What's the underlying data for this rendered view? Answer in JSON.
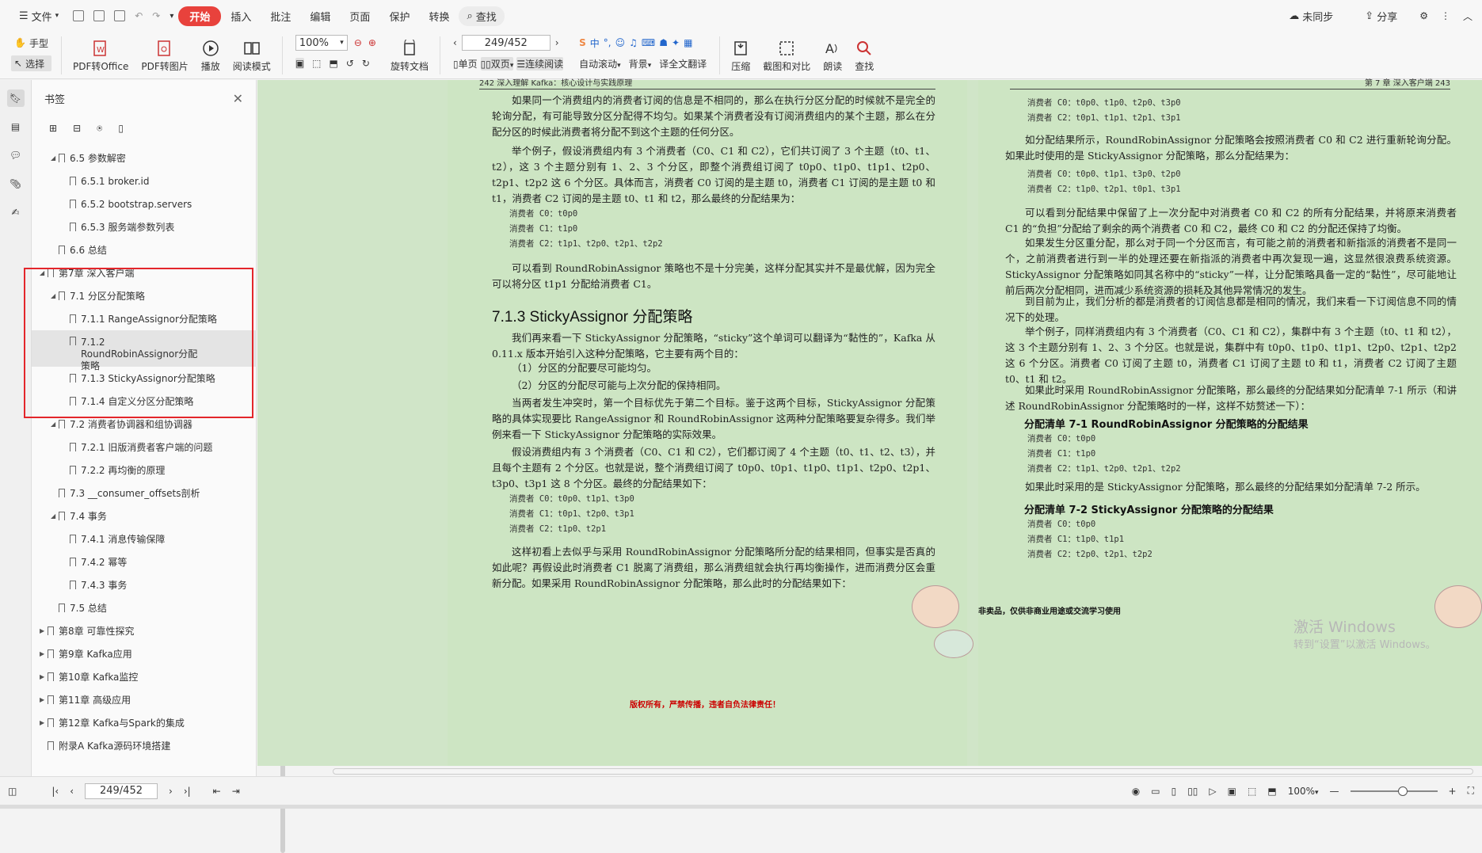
{
  "menubar": {
    "file": "文件",
    "start": "开始",
    "items": [
      "插入",
      "批注",
      "编辑",
      "页面",
      "保护",
      "转换"
    ],
    "search": "查找",
    "sync": "未同步",
    "share": "分享"
  },
  "toolbar": {
    "hand": "手型",
    "select": "选择",
    "pdf_to_office": "PDF转Office",
    "pdf_to_image": "PDF转图片",
    "play": "播放",
    "read_mode": "阅读模式",
    "zoom": "100%",
    "rotate": "旋转文档",
    "page_field": "249/452",
    "single": "单页",
    "double": "双页",
    "continuous": "连续阅读",
    "autoscroll": "自动滚动",
    "background": "背景",
    "translate": "全文翻译",
    "compress": "压缩",
    "compare": "截图和对比",
    "read_aloud": "朗读",
    "find": "查找"
  },
  "panel": {
    "title": "书签",
    "tree": [
      {
        "level": 1,
        "label": "6.5 参数解密",
        "expand": "down"
      },
      {
        "level": 2,
        "label": "6.5.1 broker.id"
      },
      {
        "level": 2,
        "label": "6.5.2 bootstrap.servers"
      },
      {
        "level": 2,
        "label": "6.5.3 服务端参数列表"
      },
      {
        "level": 1,
        "label": "6.6 总结"
      },
      {
        "level": 0,
        "label": "第7章 深入客户端",
        "expand": "down"
      },
      {
        "level": 1,
        "label": "7.1 分区分配策略",
        "expand": "down"
      },
      {
        "level": 2,
        "label": "7.1.1 RangeAssignor分配策略"
      },
      {
        "level": 2,
        "label": "7.1.2 RoundRobinAssignor分配策略",
        "active": true
      },
      {
        "level": 2,
        "label": "7.1.3 StickyAssignor分配策略"
      },
      {
        "level": 2,
        "label": "7.1.4 自定义分区分配策略"
      },
      {
        "level": 1,
        "label": "7.2 消费者协调器和组协调器",
        "expand": "down"
      },
      {
        "level": 2,
        "label": "7.2.1 旧版消费者客户端的问题"
      },
      {
        "level": 2,
        "label": "7.2.2 再均衡的原理"
      },
      {
        "level": 1,
        "label": "7.3 __consumer_offsets剖析"
      },
      {
        "level": 1,
        "label": "7.4 事务",
        "expand": "down"
      },
      {
        "level": 2,
        "label": "7.4.1 消息传输保障"
      },
      {
        "level": 2,
        "label": "7.4.2 幂等"
      },
      {
        "level": 2,
        "label": "7.4.3 事务"
      },
      {
        "level": 1,
        "label": "7.5 总结"
      },
      {
        "level": 0,
        "label": "第8章 可靠性探究",
        "expand": "right"
      },
      {
        "level": 0,
        "label": "第9章 Kafka应用",
        "expand": "right"
      },
      {
        "level": 0,
        "label": "第10章 Kafka监控",
        "expand": "right"
      },
      {
        "level": 0,
        "label": "第11章 高级应用",
        "expand": "right"
      },
      {
        "level": 0,
        "label": "第12章 Kafka与Spark的集成",
        "expand": "right"
      },
      {
        "level": 0,
        "label": "附录A Kafka源码环境搭建"
      }
    ]
  },
  "left_page": {
    "header_left": "242    深入理解 Kafka：核心设计与实践原理",
    "p1": "如果同一个消费组内的消费者订阅的信息是不相同的，那么在执行分区分配的时候就不是完全的轮询分配，有可能导致分区分配得不均匀。如果某个消费者没有订阅消费组内的某个主题，那么在分配分区的时候此消费者将分配不到这个主题的任何分区。",
    "p2": "举个例子，假设消费组内有 3 个消费者（C0、C1 和 C2），它们共订阅了 3 个主题（t0、t1、t2），这 3 个主题分别有 1、2、3 个分区，即整个消费组订阅了 t0p0、t1p0、t1p1、t2p0、t2p1、t2p2 这 6 个分区。具体而言，消费者 C0 订阅的是主题 t0，消费者 C1 订阅的是主题 t0 和 t1，消费者 C2 订阅的是主题 t0、t1 和 t2，那么最终的分配结果为：",
    "c1": [
      "消费者 C0：t0p0",
      "消费者 C1：t1p0",
      "消费者 C2：t1p1、t2p0、t2p1、t2p2"
    ],
    "p3": "可以看到 RoundRobinAssignor 策略也不是十分完美，这样分配其实并不是最优解，因为完全可以将分区 t1p1 分配给消费者 C1。",
    "h3": "7.1.3   StickyAssignor 分配策略",
    "p4": "我们再来看一下 StickyAssignor 分配策略，“sticky”这个单词可以翻译为“黏性的”，Kafka 从 0.11.x 版本开始引入这种分配策略，它主要有两个目的：",
    "li1": "（1）分区的分配要尽可能均匀。",
    "li2": "（2）分区的分配尽可能与上次分配的保持相同。",
    "p5": "当两者发生冲突时，第一个目标优先于第二个目标。鉴于这两个目标，StickyAssignor 分配策略的具体实现要比 RangeAssignor 和 RoundRobinAssignor 这两种分配策略要复杂得多。我们举例来看一下 StickyAssignor 分配策略的实际效果。",
    "p6": "假设消费组内有 3 个消费者（C0、C1 和 C2），它们都订阅了 4 个主题（t0、t1、t2、t3），并且每个主题有 2 个分区。也就是说，整个消费组订阅了 t0p0、t0p1、t1p0、t1p1、t2p0、t2p1、t3p0、t3p1 这 8 个分区。最终的分配结果如下：",
    "c2": [
      "消费者 C0：t0p0、t1p1、t3p0",
      "消费者 C1：t0p1、t2p0、t3p1",
      "消费者 C2：t1p0、t2p1"
    ],
    "p7": "这样初看上去似乎与采用 RoundRobinAssignor 分配策略所分配的结果相同，但事实是否真的如此呢？再假设此时消费者 C1 脱离了消费组，那么消费组就会执行再均衡操作，进而消费分区会重新分配。如果采用 RoundRobinAssignor 分配策略，那么此时的分配结果如下：",
    "footer": "版权所有，严禁传播，违者自负法律责任！"
  },
  "right_page": {
    "header_right": "第 7 章  深入客户端     243",
    "c1": [
      "消费者 C0：t0p0、t1p0、t2p0、t3p0",
      "消费者 C2：t0p1、t1p1、t2p1、t3p1"
    ],
    "p1": "如分配结果所示，RoundRobinAssignor 分配策略会按照消费者 C0 和 C2 进行重新轮询分配。如果此时使用的是 StickyAssignor 分配策略，那么分配结果为：",
    "c2": [
      "消费者 C0：t0p0、t1p1、t3p0、t2p0",
      "消费者 C2：t1p0、t2p1、t0p1、t3p1"
    ],
    "p2": "可以看到分配结果中保留了上一次分配中对消费者 C0 和 C2 的所有分配结果，并将原来消费者 C1 的“负担”分配给了剩余的两个消费者 C0 和 C2，最终 C0 和 C2 的分配还保持了均衡。",
    "p3": "如果发生分区重分配，那么对于同一个分区而言，有可能之前的消费者和新指派的消费者不是同一个，之前消费者进行到一半的处理还要在新指派的消费者中再次复现一遍，这显然很浪费系统资源。StickyAssignor 分配策略如同其名称中的“sticky”一样，让分配策略具备一定的“黏性”，尽可能地让前后两次分配相同，进而减少系统资源的损耗及其他异常情况的发生。",
    "p4": "到目前为止，我们分析的都是消费者的订阅信息都是相同的情况，我们来看一下订阅信息不同的情况下的处理。",
    "p5": "举个例子，同样消费组内有 3 个消费者（C0、C1 和 C2），集群中有 3 个主题（t0、t1 和 t2），这 3 个主题分别有 1、2、3 个分区。也就是说，集群中有 t0p0、t1p0、t1p1、t2p0、t2p1、t2p2 这 6 个分区。消费者 C0 订阅了主题 t0，消费者 C1 订阅了主题 t0 和 t1，消费者 C2 订阅了主题 t0、t1 和 t2。",
    "p6": "如果此时采用 RoundRobinAssignor 分配策略，那么最终的分配结果如分配清单 7-1 所示（和讲述 RoundRobinAssignor 分配策略时的一样，这样不妨赘述一下）：",
    "h4a": "分配清单 7-1    RoundRobinAssignor 分配策略的分配结果",
    "c3": [
      "消费者 C0：t0p0",
      "消费者 C1：t1p0",
      "消费者 C2：t1p1、t2p0、t2p1、t2p2"
    ],
    "p7": "如果此时采用的是 StickyAssignor 分配策略，那么最终的分配结果如分配清单 7-2 所示。",
    "h4b": "分配清单 7-2    StickyAssignor 分配策略的分配结果",
    "c4": [
      "消费者 C0：t0p0",
      "消费者 C1：t1p0、t1p1",
      "消费者 C2：t2p0、t2p1、t2p2"
    ],
    "footer": "非卖品，仅供非商业用途或交流学习使用"
  },
  "watermark": {
    "line1": "激活 Windows",
    "line2": "转到“设置”以激活 Windows。"
  },
  "status": {
    "page": "249/452",
    "zoom": "100%"
  }
}
